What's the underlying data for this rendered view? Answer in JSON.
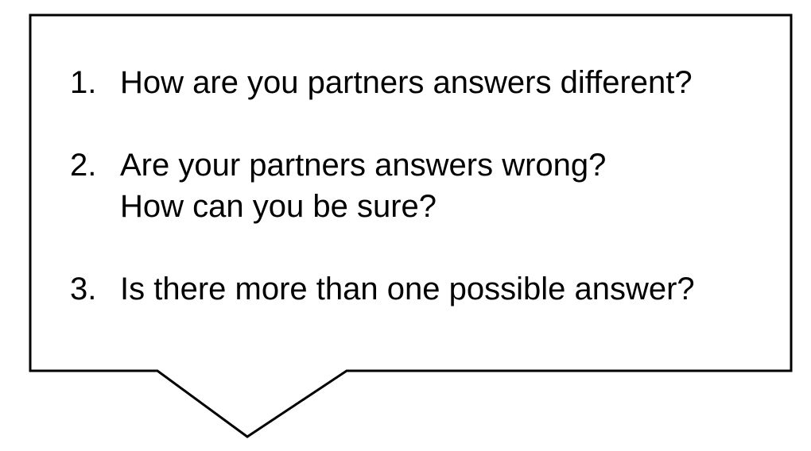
{
  "callout": {
    "border_color": "#000000",
    "fill_color": "#ffffff"
  },
  "questions": [
    {
      "number": "1.",
      "lines": [
        "How are you partners answers different?"
      ]
    },
    {
      "number": "2.",
      "lines": [
        "Are your partners answers wrong?",
        "How can you be sure?"
      ]
    },
    {
      "number": "3.",
      "lines": [
        "Is there more than one possible answer?"
      ]
    }
  ]
}
